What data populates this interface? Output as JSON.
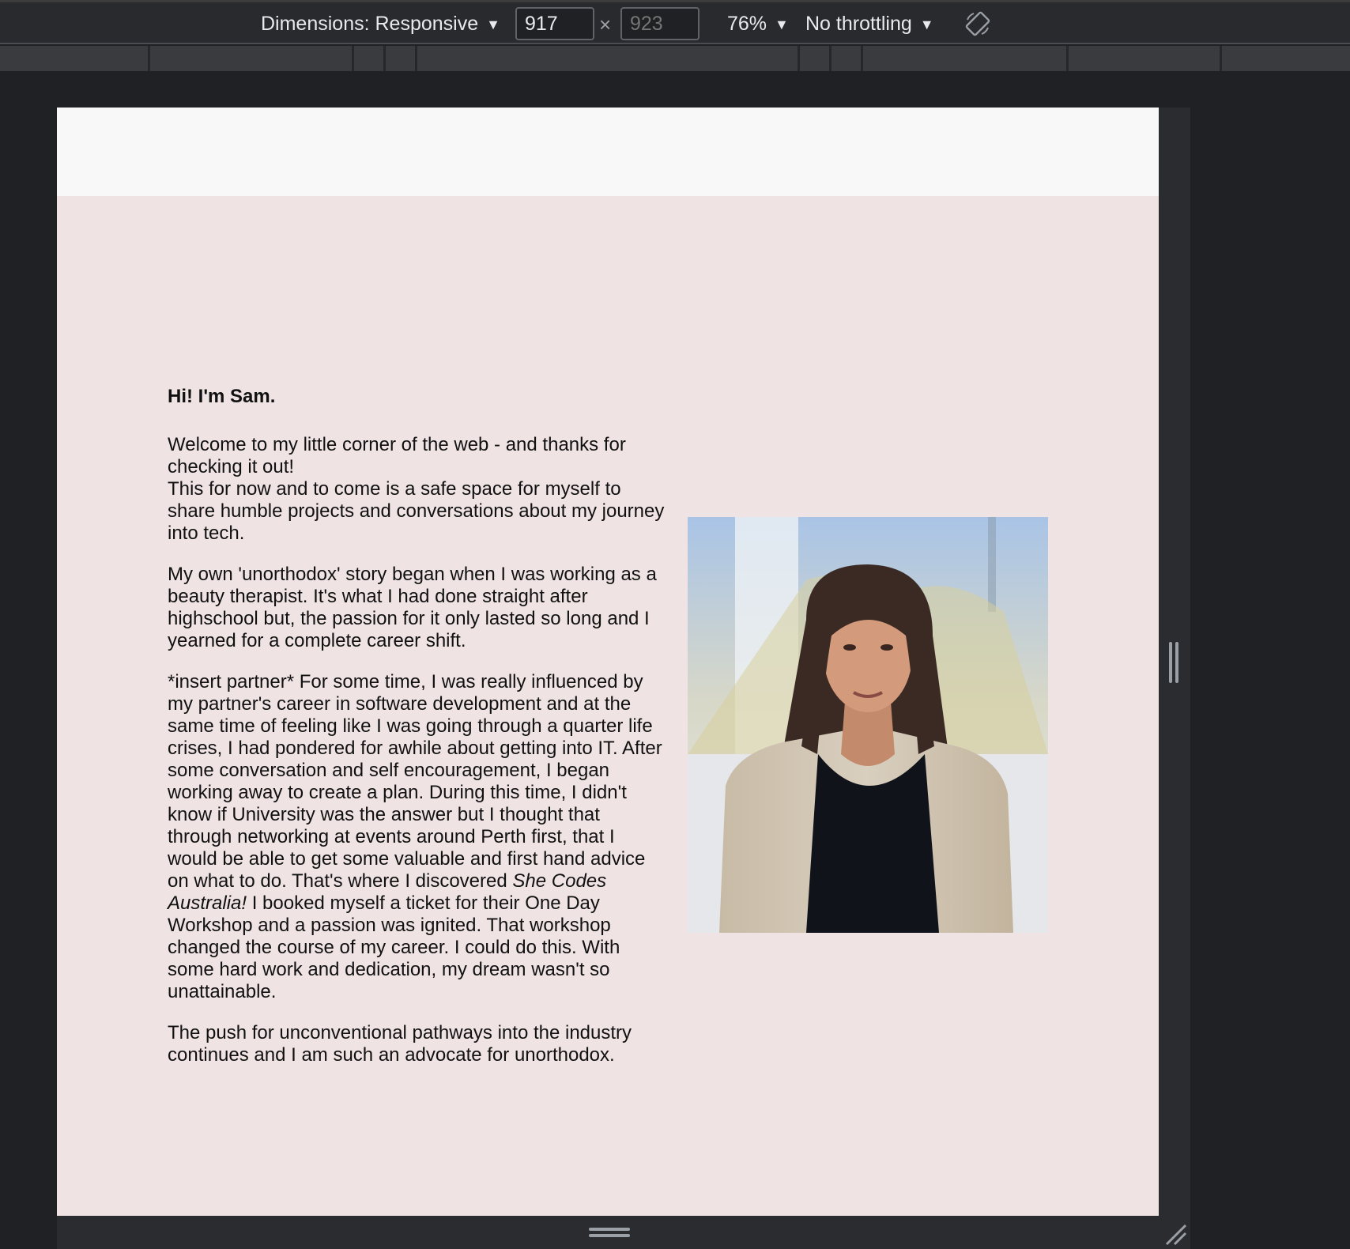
{
  "toolbar": {
    "dimensions_label": "Dimensions: Responsive",
    "width_value": "917",
    "height_value": "923",
    "times": "×",
    "zoom_label": "76%",
    "throttling_label": "No throttling",
    "caret": "▼"
  },
  "about": {
    "heading": "Hi! I'm Sam.",
    "p1_line1": "Welcome to my little corner of the web - and thanks for checking it out!",
    "p1_line2": "This for now and to come is a safe space for myself to share humble projects and conversations about my journey into tech.",
    "p2": "My own 'unorthodox' story began when I was working as a beauty therapist. It's what I had done straight after highschool but, the passion for it only lasted so long and I yearned for a complete career shift.",
    "p3_before": "*insert partner* For some time, I was really influenced by my partner's career in software development and at the same time of feeling like I was going through a quarter life crises, I had pondered for awhile about getting into IT. After some conversation and self encouragement, I began working away to create a plan. During this time, I didn't know if University was the answer but I thought that through networking at events around Perth first, that I would be able to get some valuable and first hand advice on what to do. That's where I discovered ",
    "p3_em": "She Codes Australia!",
    "p3_after": " I booked myself a ticket for their One Day Workshop and a passion was ignited. That workshop changed the course of my career. I could do this. With some hard work and dedication, my dream wasn't so unattainable.",
    "p4": "The push for unconventional pathways into the industry continues and I am such an advocate for unorthodox."
  },
  "icons": {
    "rotate": "rotate-icon",
    "caret": "caret-down-icon",
    "photo": "portrait-photo"
  },
  "colors": {
    "devtools_bg": "#202124",
    "page_bg": "#efe3e4",
    "header_bg": "#f8f8f8"
  }
}
